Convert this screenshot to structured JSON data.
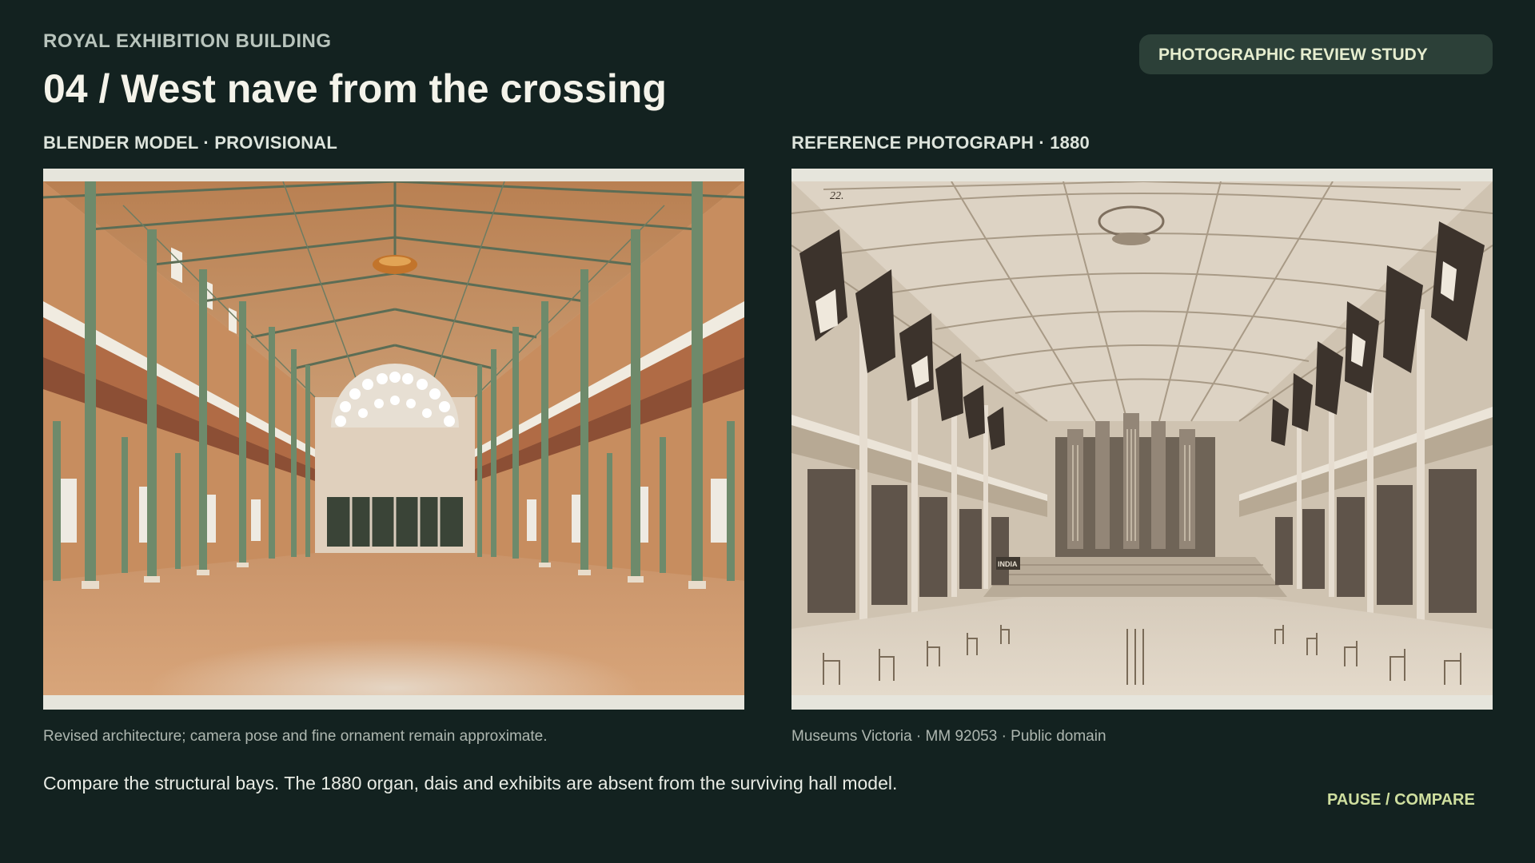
{
  "header": {
    "eyebrow": "ROYAL EXHIBITION BUILDING",
    "title": "04  /  West nave from the crossing",
    "badge": "PHOTOGRAPHIC REVIEW STUDY"
  },
  "panels": {
    "model": {
      "label": "BLENDER MODEL · PROVISIONAL",
      "caption": "Revised architecture; camera pose and fine ornament remain approximate."
    },
    "photo": {
      "label": "REFERENCE PHOTOGRAPH · 1880",
      "caption": "Museums Victoria · MM 92053 · Public domain",
      "plate_number": "22.",
      "sign_text": "INDIA"
    }
  },
  "note": "Compare the structural bays. The 1880 organ, dais and exhibits are absent from the surviving hall model.",
  "actions": {
    "pause_label": "PAUSE / COMPARE"
  },
  "colors": {
    "background": "#132220",
    "badge_bg": "#2c4038",
    "accent": "#cfdf9f"
  }
}
